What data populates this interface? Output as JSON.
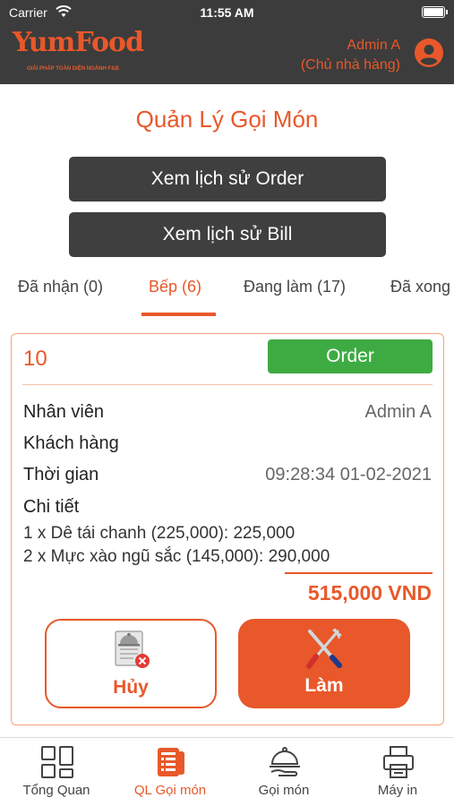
{
  "status_bar": {
    "carrier": "Carrier",
    "time": "11:55 AM"
  },
  "header": {
    "logo_text": "YumFood",
    "logo_tagline": "GIẢI PHÁP TOÀN DIỆN NGÀNH F&B",
    "user_name": "Admin A",
    "user_role": "(Chủ nhà hàng)"
  },
  "page": {
    "title": "Quản Lý Gọi Món",
    "order_history_label": "Xem lịch sử Order",
    "bill_history_label": "Xem lịch sử Bill"
  },
  "tabs": [
    {
      "label": "Đã nhận (0)",
      "active": false
    },
    {
      "label": "Bếp (6)",
      "active": true
    },
    {
      "label": "Đang làm (17)",
      "active": false
    },
    {
      "label": "Đã xong",
      "active": false
    }
  ],
  "order": {
    "number": "10",
    "badge": "Order",
    "staff_label": "Nhân viên",
    "staff_value": "Admin A",
    "customer_label": "Khách hàng",
    "customer_value": "",
    "time_label": "Thời gian",
    "time_value": "09:28:34 01-02-2021",
    "detail_label": "Chi tiết",
    "items": [
      "1 x Dê tái chanh (225,000): 225,000",
      "2 x Mực xào ngũ sắc (145,000): 290,000"
    ],
    "total": "515,000 VND",
    "cancel_label": "Hủy",
    "make_label": "Làm"
  },
  "bottom_nav": [
    {
      "label": "Tổng Quan",
      "icon": "dashboard-icon",
      "active": false
    },
    {
      "label": "QL Gọi món",
      "icon": "order-management-icon",
      "active": true
    },
    {
      "label": "Gọi món",
      "icon": "food-cloche-icon",
      "active": false
    },
    {
      "label": "Máy in",
      "icon": "printer-icon",
      "active": false
    }
  ],
  "colors": {
    "accent": "#e8582a",
    "header_bg": "#3c3c3c",
    "badge_green": "#3eab42"
  }
}
